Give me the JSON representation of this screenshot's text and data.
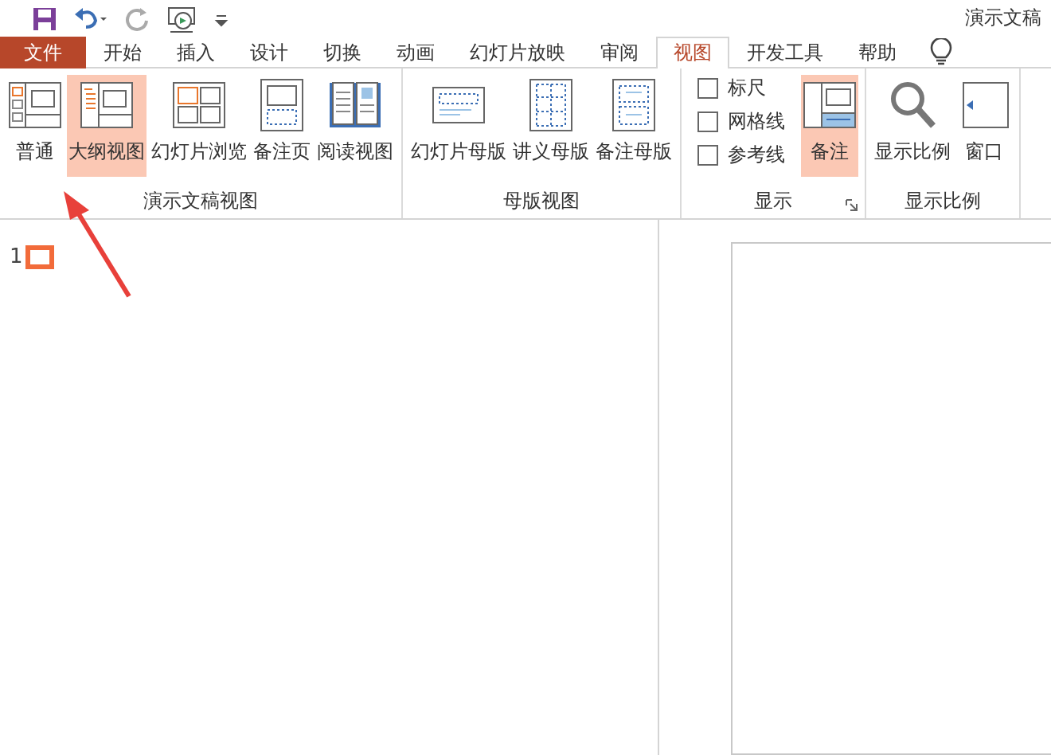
{
  "window": {
    "title": "演示文稿"
  },
  "tabs": [
    {
      "label": "文件",
      "kind": "file",
      "selected": false
    },
    {
      "label": "开始",
      "kind": "tab",
      "selected": false
    },
    {
      "label": "插入",
      "kind": "tab",
      "selected": false
    },
    {
      "label": "设计",
      "kind": "tab",
      "selected": false
    },
    {
      "label": "切换",
      "kind": "tab",
      "selected": false
    },
    {
      "label": "动画",
      "kind": "tab",
      "selected": false
    },
    {
      "label": "幻灯片放映",
      "kind": "tab",
      "selected": false
    },
    {
      "label": "审阅",
      "kind": "tab",
      "selected": false
    },
    {
      "label": "视图",
      "kind": "tab",
      "selected": true
    },
    {
      "label": "开发工具",
      "kind": "tab",
      "selected": false
    },
    {
      "label": "帮助",
      "kind": "tab",
      "selected": false
    }
  ],
  "ribbon_groups": [
    {
      "label": "演示文稿视图",
      "items": [
        {
          "kind": "button",
          "label": "普通",
          "selected": false
        },
        {
          "kind": "button",
          "label": "大纲视图",
          "selected": true
        },
        {
          "kind": "button",
          "label": "幻灯片浏览",
          "selected": false
        },
        {
          "kind": "button",
          "label": "备注页",
          "selected": false
        },
        {
          "kind": "button",
          "label": "阅读视图",
          "selected": false
        }
      ]
    },
    {
      "label": "母版视图",
      "items": [
        {
          "kind": "button",
          "label": "幻灯片母版",
          "selected": false
        },
        {
          "kind": "button",
          "label": "讲义母版",
          "selected": false
        },
        {
          "kind": "button",
          "label": "备注母版",
          "selected": false
        }
      ]
    },
    {
      "label": "显示",
      "items": [
        {
          "kind": "checkboxes",
          "boxes": [
            {
              "label": "标尺",
              "checked": false
            },
            {
              "label": "网格线",
              "checked": false
            },
            {
              "label": "参考线",
              "checked": false
            }
          ]
        },
        {
          "kind": "button",
          "label": "备注",
          "selected": true
        }
      ]
    },
    {
      "label": "显示比例",
      "items": [
        {
          "kind": "button",
          "label": "显示比例",
          "selected": false
        },
        {
          "kind": "button",
          "label": "窗口",
          "selected": false
        }
      ]
    }
  ],
  "outline": {
    "slides": [
      {
        "number": "1",
        "selected": true
      }
    ]
  }
}
